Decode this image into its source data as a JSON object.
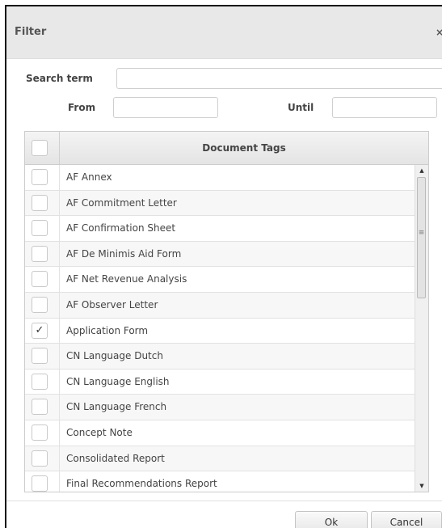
{
  "dialog": {
    "title": "Filter",
    "close_icon": "×"
  },
  "search": {
    "label": "Search term",
    "value": "",
    "placeholder": ""
  },
  "from": {
    "label": "From",
    "value": ""
  },
  "until": {
    "label": "Until",
    "value": ""
  },
  "table": {
    "header": "Document Tags",
    "check_glyph": "✓",
    "rows": [
      {
        "label": "AF Annex",
        "checked": false
      },
      {
        "label": "AF Commitment Letter",
        "checked": false
      },
      {
        "label": "AF Confirmation Sheet",
        "checked": false
      },
      {
        "label": "AF De Minimis Aid Form",
        "checked": false
      },
      {
        "label": "AF Net Revenue Analysis",
        "checked": false
      },
      {
        "label": "AF Observer Letter",
        "checked": false
      },
      {
        "label": "Application Form",
        "checked": true
      },
      {
        "label": "CN Language Dutch",
        "checked": false
      },
      {
        "label": "CN Language English",
        "checked": false
      },
      {
        "label": "CN Language French",
        "checked": false
      },
      {
        "label": "Concept Note",
        "checked": false
      },
      {
        "label": "Consolidated Report",
        "checked": false
      },
      {
        "label": "Final Recommendations Report",
        "checked": false
      }
    ]
  },
  "scrollbar": {
    "up_icon": "▲",
    "down_icon": "▼",
    "grip_icon": "≡",
    "position": 0.0
  },
  "buttons": {
    "ok": "Ok",
    "cancel": "Cancel"
  }
}
